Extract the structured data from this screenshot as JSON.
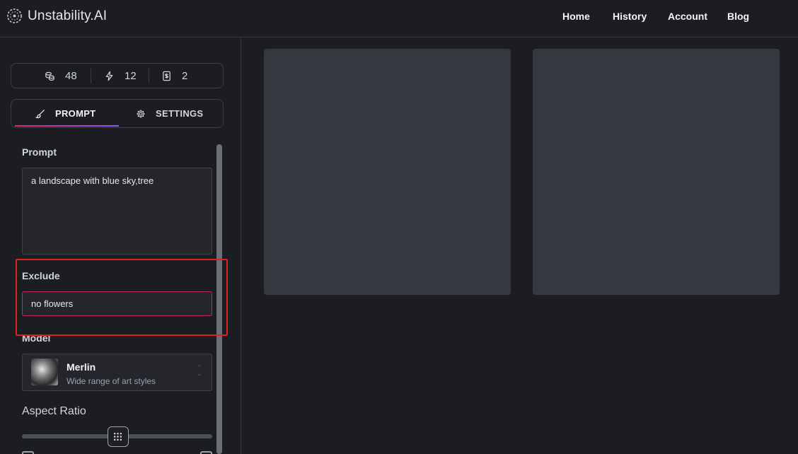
{
  "app": {
    "title": "Unstability.AI"
  },
  "nav": [
    {
      "label": "Home"
    },
    {
      "label": "History"
    },
    {
      "label": "Account"
    },
    {
      "label": "Blog"
    }
  ],
  "stats": [
    {
      "icon": "coins-icon",
      "value": "48"
    },
    {
      "icon": "bolt-icon",
      "value": "12"
    },
    {
      "icon": "receipt-icon",
      "value": "2"
    }
  ],
  "tabs": [
    {
      "label": "PROMPT",
      "icon": "brush-icon",
      "active": true
    },
    {
      "label": "SETTINGS",
      "icon": "gear-icon",
      "active": false
    }
  ],
  "form": {
    "prompt_label": "Prompt",
    "prompt_value": "a landscape with blue sky,tree",
    "exclude_label": "Exclude",
    "exclude_value": "no flowers",
    "model_label": "Model",
    "model_name": "Merlin",
    "model_desc": "Wide range of art styles",
    "aspect_label": "Aspect Ratio",
    "aspect_slider_fraction": 0.5
  },
  "colors": {
    "accent_gradient_start": "#db2777",
    "accent_gradient_end": "#8b5cf6",
    "highlight": "#e02020",
    "background": "#1c1d21",
    "image_placeholder": "#35383e"
  }
}
